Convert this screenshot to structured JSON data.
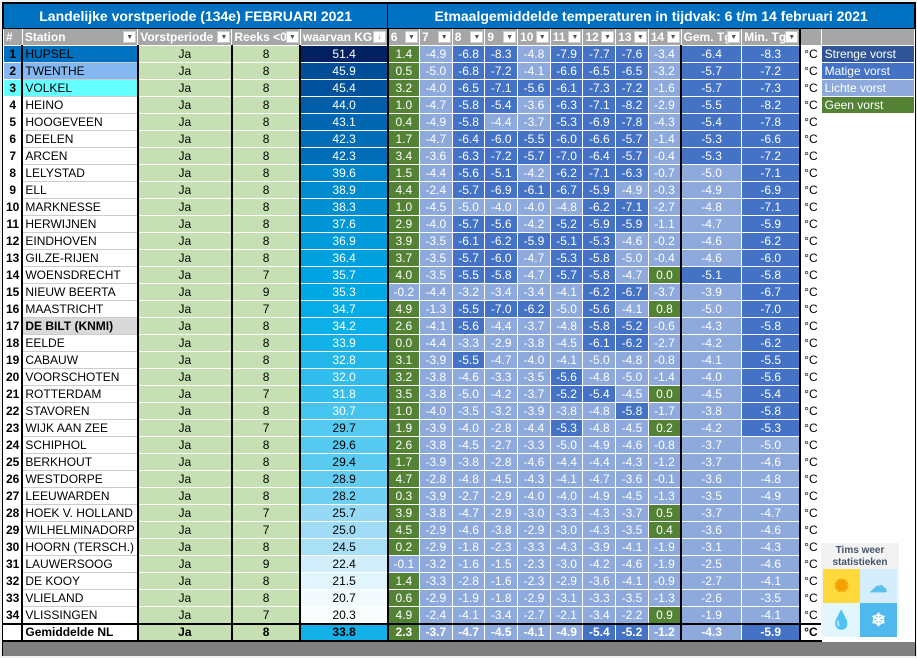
{
  "title_left": "Landelijke vorstperiode (134e) FEBRUARI 2021",
  "title_right": "Etmaalgemiddelde temperaturen in tijdvak: 6 t/m 14 februari 2021",
  "headers": {
    "rank": "#",
    "station": "Station",
    "vorstperiode": "Vorstperiode",
    "reeks": "Reeks <0",
    "kg": "waarvan KG",
    "days": [
      "6",
      "7",
      "8",
      "9",
      "10",
      "11",
      "12",
      "13",
      "14"
    ],
    "gem": "Gem. Tg",
    "min": "Min. Tg"
  },
  "unit": "°C",
  "legend": [
    {
      "label": "Strenge vorst",
      "color": "#2F5597"
    },
    {
      "label": "Matige vorst",
      "color": "#4472C4"
    },
    {
      "label": "Lichte vorst",
      "color": "#8EA9DB"
    },
    {
      "label": "Geen vorst",
      "color": "#548235"
    }
  ],
  "logo_text": "Tims weer statistieken",
  "rows": [
    {
      "rank": "1",
      "station": "HUPSEL",
      "vp": "Ja",
      "reeks": "8",
      "kg": "51.4",
      "days": [
        "1.4",
        "-4.9",
        "-6.8",
        "-8.3",
        "-4.8",
        "-7.9",
        "-7.7",
        "-7.6",
        "-3.4"
      ],
      "gem": "-6.4",
      "min": "-8.3"
    },
    {
      "rank": "2",
      "station": "TWENTHE",
      "vp": "Ja",
      "reeks": "8",
      "kg": "45.9",
      "days": [
        "0.5",
        "-5.0",
        "-6.8",
        "-7.2",
        "-4.1",
        "-6.6",
        "-6.5",
        "-6.5",
        "-3.2"
      ],
      "gem": "-5.7",
      "min": "-7.2"
    },
    {
      "rank": "3",
      "station": "VOLKEL",
      "vp": "Ja",
      "reeks": "8",
      "kg": "45.4",
      "days": [
        "3.2",
        "-4.0",
        "-6.5",
        "-7.1",
        "-5.6",
        "-6.1",
        "-7.3",
        "-7.2",
        "-1.6"
      ],
      "gem": "-5.7",
      "min": "-7.3"
    },
    {
      "rank": "4",
      "station": "HEINO",
      "vp": "Ja",
      "reeks": "8",
      "kg": "44.0",
      "days": [
        "1.0",
        "-4.7",
        "-5.8",
        "-5.4",
        "-3.6",
        "-6.3",
        "-7.1",
        "-8.2",
        "-2.9"
      ],
      "gem": "-5.5",
      "min": "-8.2"
    },
    {
      "rank": "5",
      "station": "HOOGEVEEN",
      "vp": "Ja",
      "reeks": "8",
      "kg": "43.1",
      "days": [
        "0.4",
        "-4.9",
        "-5.8",
        "-4.4",
        "-3.7",
        "-5.3",
        "-6.9",
        "-7.8",
        "-4.3"
      ],
      "gem": "-5.4",
      "min": "-7.8"
    },
    {
      "rank": "6",
      "station": "DEELEN",
      "vp": "Ja",
      "reeks": "8",
      "kg": "42.3",
      "days": [
        "1.7",
        "-4.7",
        "-6.4",
        "-6.0",
        "-5.5",
        "-6.0",
        "-6.6",
        "-5.7",
        "-1.4"
      ],
      "gem": "-5.3",
      "min": "-6.6"
    },
    {
      "rank": "7",
      "station": "ARCEN",
      "vp": "Ja",
      "reeks": "8",
      "kg": "42.3",
      "days": [
        "3.4",
        "-3.6",
        "-6.3",
        "-7.2",
        "-5.7",
        "-7.0",
        "-6.4",
        "-5.7",
        "-0.4"
      ],
      "gem": "-5.3",
      "min": "-7.2"
    },
    {
      "rank": "8",
      "station": "LELYSTAD",
      "vp": "Ja",
      "reeks": "8",
      "kg": "39.6",
      "days": [
        "1.5",
        "-4.4",
        "-5.6",
        "-5.1",
        "-4.2",
        "-6.2",
        "-7.1",
        "-6.3",
        "-0.7"
      ],
      "gem": "-5.0",
      "min": "-7.1"
    },
    {
      "rank": "9",
      "station": "ELL",
      "vp": "Ja",
      "reeks": "8",
      "kg": "38.9",
      "days": [
        "4.4",
        "-2.4",
        "-5.7",
        "-6.9",
        "-6.1",
        "-6.7",
        "-5.9",
        "-4.9",
        "-0.3"
      ],
      "gem": "-4.9",
      "min": "-6.9"
    },
    {
      "rank": "10",
      "station": "MARKNESSE",
      "vp": "Ja",
      "reeks": "8",
      "kg": "38.3",
      "days": [
        "1.0",
        "-4.5",
        "-5.0",
        "-4.0",
        "-4.0",
        "-4.8",
        "-6.2",
        "-7.1",
        "-2.7"
      ],
      "gem": "-4.8",
      "min": "-7.1"
    },
    {
      "rank": "11",
      "station": "HERWIJNEN",
      "vp": "Ja",
      "reeks": "8",
      "kg": "37.6",
      "days": [
        "2.9",
        "-4.0",
        "-5.7",
        "-5.6",
        "-4.2",
        "-5.2",
        "-5.9",
        "-5.9",
        "-1.1"
      ],
      "gem": "-4.7",
      "min": "-5.9"
    },
    {
      "rank": "12",
      "station": "EINDHOVEN",
      "vp": "Ja",
      "reeks": "8",
      "kg": "36.9",
      "days": [
        "3.9",
        "-3.5",
        "-6.1",
        "-6.2",
        "-5.9",
        "-5.1",
        "-5.3",
        "-4.6",
        "-0.2"
      ],
      "gem": "-4.6",
      "min": "-6.2"
    },
    {
      "rank": "13",
      "station": "GILZE-RIJEN",
      "vp": "Ja",
      "reeks": "8",
      "kg": "36.4",
      "days": [
        "3.7",
        "-3.5",
        "-5.7",
        "-6.0",
        "-4.7",
        "-5.3",
        "-5.8",
        "-5.0",
        "-0.4"
      ],
      "gem": "-4.6",
      "min": "-6.0"
    },
    {
      "rank": "14",
      "station": "WOENSDRECHT",
      "vp": "Ja",
      "reeks": "7",
      "kg": "35.7",
      "days": [
        "4.0",
        "-3.5",
        "-5.5",
        "-5.8",
        "-4.7",
        "-5.7",
        "-5.8",
        "-4.7",
        "0.0"
      ],
      "gem": "-5.1",
      "min": "-5.8"
    },
    {
      "rank": "15",
      "station": "NIEUW BEERTA",
      "vp": "Ja",
      "reeks": "9",
      "kg": "35.3",
      "days": [
        "-0.2",
        "-4.4",
        "-3.2",
        "-3.4",
        "-3.4",
        "-4.1",
        "-6.2",
        "-6.7",
        "-3.7"
      ],
      "gem": "-3.9",
      "min": "-6.7"
    },
    {
      "rank": "16",
      "station": "MAASTRICHT",
      "vp": "Ja",
      "reeks": "7",
      "kg": "34.7",
      "days": [
        "4.9",
        "-1.3",
        "-5.5",
        "-7.0",
        "-6.2",
        "-5.0",
        "-5.6",
        "-4.1",
        "0.8"
      ],
      "gem": "-5.0",
      "min": "-7.0"
    },
    {
      "rank": "17",
      "station": "DE BILT (KNMI)",
      "vp": "Ja",
      "reeks": "8",
      "kg": "34.2",
      "days": [
        "2.6",
        "-4.1",
        "-5.6",
        "-4.4",
        "-3.7",
        "-4.8",
        "-5.8",
        "-5.2",
        "-0.6"
      ],
      "gem": "-4.3",
      "min": "-5.8"
    },
    {
      "rank": "18",
      "station": "EELDE",
      "vp": "Ja",
      "reeks": "8",
      "kg": "33.9",
      "days": [
        "0.0",
        "-4.4",
        "-3.3",
        "-2.9",
        "-3.8",
        "-4.5",
        "-6.1",
        "-6.2",
        "-2.7"
      ],
      "gem": "-4.2",
      "min": "-6.2"
    },
    {
      "rank": "19",
      "station": "CABAUW",
      "vp": "Ja",
      "reeks": "8",
      "kg": "32.8",
      "days": [
        "3.1",
        "-3.9",
        "-5.5",
        "-4.7",
        "-4.0",
        "-4.1",
        "-5.0",
        "-4.8",
        "-0.8"
      ],
      "gem": "-4.1",
      "min": "-5.5"
    },
    {
      "rank": "20",
      "station": "VOORSCHOTEN",
      "vp": "Ja",
      "reeks": "8",
      "kg": "32.0",
      "days": [
        "3.2",
        "-3.8",
        "-4.6",
        "-3.3",
        "-3.5",
        "-5.6",
        "-4.8",
        "-5.0",
        "-1.4"
      ],
      "gem": "-4.0",
      "min": "-5.6"
    },
    {
      "rank": "21",
      "station": "ROTTERDAM",
      "vp": "Ja",
      "reeks": "7",
      "kg": "31.8",
      "days": [
        "3.5",
        "-3.8",
        "-5.0",
        "-4.2",
        "-3.7",
        "-5.2",
        "-5.4",
        "-4.5",
        "0.0"
      ],
      "gem": "-4.5",
      "min": "-5.4"
    },
    {
      "rank": "22",
      "station": "STAVOREN",
      "vp": "Ja",
      "reeks": "8",
      "kg": "30.7",
      "days": [
        "1.0",
        "-4.0",
        "-3.5",
        "-3.2",
        "-3.9",
        "-3.8",
        "-4.8",
        "-5.8",
        "-1.7"
      ],
      "gem": "-3.8",
      "min": "-5.8"
    },
    {
      "rank": "23",
      "station": "WIJK AAN ZEE",
      "vp": "Ja",
      "reeks": "7",
      "kg": "29.7",
      "days": [
        "1.9",
        "-3.9",
        "-4.0",
        "-2.8",
        "-4.4",
        "-5.3",
        "-4.8",
        "-4.5",
        "0.2"
      ],
      "gem": "-4.2",
      "min": "-5.3"
    },
    {
      "rank": "24",
      "station": "SCHIPHOL",
      "vp": "Ja",
      "reeks": "8",
      "kg": "29.6",
      "days": [
        "2.6",
        "-3.8",
        "-4.5",
        "-2.7",
        "-3.3",
        "-5.0",
        "-4.9",
        "-4.6",
        "-0.8"
      ],
      "gem": "-3.7",
      "min": "-5.0"
    },
    {
      "rank": "25",
      "station": "BERKHOUT",
      "vp": "Ja",
      "reeks": "8",
      "kg": "29.4",
      "days": [
        "1.7",
        "-3.9",
        "-3.8",
        "-2.8",
        "-4.6",
        "-4.4",
        "-4.4",
        "-4.3",
        "-1.2"
      ],
      "gem": "-3.7",
      "min": "-4.6"
    },
    {
      "rank": "26",
      "station": "WESTDORPE",
      "vp": "Ja",
      "reeks": "8",
      "kg": "28.9",
      "days": [
        "4.7",
        "-2.8",
        "-4.8",
        "-4.5",
        "-4.3",
        "-4.1",
        "-4.7",
        "-3.6",
        "-0.1"
      ],
      "gem": "-3.6",
      "min": "-4.8"
    },
    {
      "rank": "27",
      "station": "LEEUWARDEN",
      "vp": "Ja",
      "reeks": "8",
      "kg": "28.2",
      "days": [
        "0.3",
        "-3.9",
        "-2.7",
        "-2.9",
        "-4.0",
        "-4.0",
        "-4.9",
        "-4.5",
        "-1.3"
      ],
      "gem": "-3.5",
      "min": "-4.9"
    },
    {
      "rank": "28",
      "station": "HOEK V. HOLLAND",
      "vp": "Ja",
      "reeks": "7",
      "kg": "25.7",
      "days": [
        "3.9",
        "-3.8",
        "-4.7",
        "-2.9",
        "-3.0",
        "-3.3",
        "-4.3",
        "-3.7",
        "0.5"
      ],
      "gem": "-3.7",
      "min": "-4.7"
    },
    {
      "rank": "29",
      "station": "WILHELMINADORP",
      "vp": "Ja",
      "reeks": "7",
      "kg": "25.0",
      "days": [
        "4.5",
        "-2.9",
        "-4.6",
        "-3.8",
        "-2.9",
        "-3.0",
        "-4.3",
        "-3.5",
        "0.4"
      ],
      "gem": "-3.6",
      "min": "-4.6"
    },
    {
      "rank": "30",
      "station": "HOORN (TERSCH.)",
      "vp": "Ja",
      "reeks": "8",
      "kg": "24.5",
      "days": [
        "0.2",
        "-2.9",
        "-1.8",
        "-2.3",
        "-3.3",
        "-4.3",
        "-3.9",
        "-4.1",
        "-1.9"
      ],
      "gem": "-3.1",
      "min": "-4.3"
    },
    {
      "rank": "31",
      "station": "LAUWERSOOG",
      "vp": "Ja",
      "reeks": "9",
      "kg": "22.4",
      "days": [
        "-0.1",
        "-3.2",
        "-1.6",
        "-1.5",
        "-2.3",
        "-3.0",
        "-4.2",
        "-4.6",
        "-1.9"
      ],
      "gem": "-2.5",
      "min": "-4.6"
    },
    {
      "rank": "32",
      "station": "DE KOOY",
      "vp": "Ja",
      "reeks": "8",
      "kg": "21.5",
      "days": [
        "1.4",
        "-3.3",
        "-2.8",
        "-1.6",
        "-2.3",
        "-2.9",
        "-3.6",
        "-4.1",
        "-0.9"
      ],
      "gem": "-2.7",
      "min": "-4.1"
    },
    {
      "rank": "33",
      "station": "VLIELAND",
      "vp": "Ja",
      "reeks": "8",
      "kg": "20.7",
      "days": [
        "0.6",
        "-2.9",
        "-1.9",
        "-1.8",
        "-2.9",
        "-3.1",
        "-3.3",
        "-3.5",
        "-1.3"
      ],
      "gem": "-2.6",
      "min": "-3.5"
    },
    {
      "rank": "34",
      "station": "VLISSINGEN",
      "vp": "Ja",
      "reeks": "7",
      "kg": "20.3",
      "days": [
        "4.9",
        "-2.4",
        "-4.1",
        "-3.4",
        "-2.7",
        "-2.1",
        "-3.4",
        "-2.2",
        "0.9"
      ],
      "gem": "-1.9",
      "min": "-4.1"
    }
  ],
  "average": {
    "rank": "",
    "station": "Gemiddelde NL",
    "vp": "Ja",
    "reeks": "8",
    "kg": "33.8",
    "days": [
      "2.3",
      "-3.7",
      "-4.7",
      "-4.5",
      "-4.1",
      "-4.9",
      "-5.4",
      "-5.2",
      "-1.2"
    ],
    "gem": "-4.3",
    "min": "-5.9"
  }
}
